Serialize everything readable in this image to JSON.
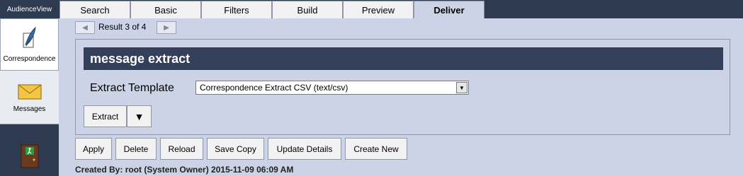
{
  "app": {
    "name": "AudienceView"
  },
  "sidebar": {
    "items": [
      {
        "label": "Correspondence",
        "icon": "quill-icon"
      },
      {
        "label": "Messages",
        "icon": "envelope-icon"
      },
      {
        "label": "",
        "icon": "exit-door-icon"
      }
    ]
  },
  "tabs": [
    {
      "label": "Search",
      "active": false
    },
    {
      "label": "Basic",
      "active": false
    },
    {
      "label": "Filters",
      "active": false
    },
    {
      "label": "Build",
      "active": false
    },
    {
      "label": "Preview",
      "active": false
    },
    {
      "label": "Deliver",
      "active": true
    }
  ],
  "result_nav": {
    "text": "Result 3 of 4",
    "prev_icon": "triangle-left-icon",
    "next_icon": "triangle-right-icon"
  },
  "panel": {
    "title": "message extract",
    "field_label": "Extract Template",
    "select_value": "Correspondence Extract CSV (text/csv)",
    "extract_label": "Extract",
    "dropdown_glyph": "▼"
  },
  "actions": {
    "apply": "Apply",
    "delete": "Delete",
    "reload": "Reload",
    "save_copy": "Save Copy",
    "update_details": "Update Details",
    "create_new": "Create New"
  },
  "footer": {
    "created_by": "Created By: root (System Owner) 2015-11-09 06:09 AM"
  },
  "colors": {
    "dark_navy": "#2d3a50",
    "panel_header": "#34405a",
    "background": "#ccd3e6"
  }
}
